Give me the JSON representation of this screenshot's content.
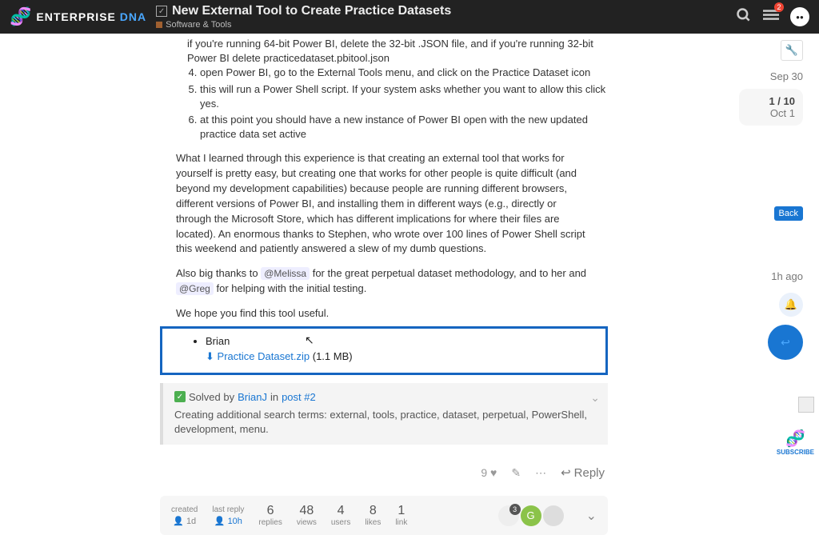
{
  "header": {
    "logo_main": "ENTERPRISE",
    "logo_accent": "DNA",
    "title": "New External Tool to Create Practice Datasets",
    "category": "Software & Tools",
    "notif_count": "2"
  },
  "post": {
    "steps": [
      "if you're running 64-bit Power BI, delete the 32-bit .JSON file, and if you're running 32-bit Power BI delete practicedataset.pbitool.json",
      "open Power BI, go to the External Tools menu, and click on the Practice Dataset icon",
      "this will run a Power Shell script. If your system asks whether you want to allow this click yes.",
      "at this point you should have a new instance of Power BI open with the new updated practice data set active"
    ],
    "para1": "What I learned through this experience is that creating an external tool that works for yourself is pretty easy, but creating one that works for other people is quite difficult (and beyond my development capabilities) because people are running different browsers, different versions of Power BI, and installing them in different ways (e.g., directly or through the Microsoft Store, which has different implications for where their files are located). An enormous thanks to Stephen, who wrote over 100 lines of Power Shell script this weekend and patiently answered a slew of my dumb questions.",
    "para2a": "Also big thanks to ",
    "mention1": "@Melissa",
    "para2b": " for the great perpetual dataset methodology, and to her and ",
    "mention2": "@Greg",
    "para2c": " for helping with the initial testing.",
    "para3": "We hope you find this tool useful.",
    "author": "Brian",
    "file_name": "Practice Dataset.zip",
    "file_size": " (1.1 MB)",
    "solved_prefix": "Solved by ",
    "solved_user": "BrianJ",
    "solved_in": " in ",
    "solved_post": "post #2",
    "solved_body": "Creating additional search terms: external, tools, practice, dataset, perpetual, PowerShell, development, menu.",
    "like_count": "9",
    "reply_label": "Reply"
  },
  "stats": {
    "created_label": "created",
    "created_val": "1d",
    "lastreply_label": "last reply",
    "lastreply_val": "10h",
    "replies_num": "6",
    "replies_lbl": "replies",
    "views_num": "48",
    "views_lbl": "views",
    "users_num": "4",
    "users_lbl": "users",
    "likes_num": "8",
    "likes_lbl": "likes",
    "link_num": "1",
    "link_lbl": "link",
    "av_count": "3"
  },
  "timeline": {
    "date": "Sep 30",
    "pos": "1 / 10",
    "end": "Oct 1",
    "back": "Back",
    "ago": "1h ago"
  },
  "subscribe": "SUBSCRIBE"
}
